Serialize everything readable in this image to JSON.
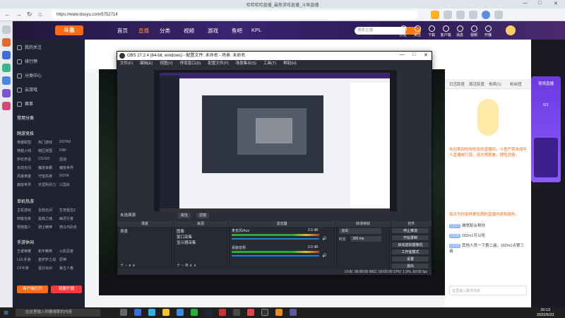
{
  "browser": {
    "tab_title": "哈哈哈哈直播_最新游戏直播_斗鱼直播",
    "url": "https://www.douyu.com/5752714",
    "win_controls": [
      "—",
      "□",
      "✕"
    ]
  },
  "douyu": {
    "logo": "斗鱼",
    "nav": [
      "首页",
      "直播",
      "分类",
      "视频",
      "游戏",
      "鱼吧",
      "KPL"
    ],
    "search_placeholder": "搜索主播",
    "top_icons": [
      "历史",
      "关注",
      "下载",
      "客户端",
      "消息",
      "视频",
      "开播"
    ]
  },
  "sidebar": {
    "items": [
      "我的关注",
      "排行榜",
      "分类中心",
      "云游戏",
      "赛事"
    ],
    "categories_title": "常用分类",
    "hot_title": "网游竞技",
    "hot_grid": [
      "英雄联盟",
      "热门游戏",
      "DOTA2",
      "穿越火线",
      "暗区突围",
      "DNF",
      "炉石传说",
      "CS:GO",
      "逆战",
      "永劫无间",
      "魔兽争霸",
      "魔兽世界",
      "风暴英雄",
      "守望先锋",
      "DOTA",
      "魔兽世界",
      "天涯明月刀",
      "三国杀"
    ],
    "single_title": "单机热游",
    "single_grid": [
      "主机游戏",
      "永劫无间",
      "生死狙击2",
      "刺客信条",
      "黑暗之魂",
      "幽灵行者",
      "怪物猎人",
      "骑士精神",
      "骑马与砍杀"
    ],
    "mobile_title": "手游休闲",
    "mobile_grid": [
      "王者荣耀",
      "和平精英",
      "火影忍者",
      "LOL手游",
      "金铲铲之战",
      "原神",
      "CF手游",
      "蛋仔派对",
      "第五人格"
    ],
    "btn_client": "客户端打开",
    "btn_record": "我要开播"
  },
  "obs": {
    "title": "OBS 27.2.4 (64-bit, windows) - 配置文件: 未命名 - 场景: 未命名",
    "menu": [
      "文件(F)",
      "编辑(E)",
      "视图(V)",
      "停靠窗口(D)",
      "配置文件(P)",
      "场景集合(S)",
      "工具(T)",
      "帮助(H)"
    ],
    "no_source": "未选择源",
    "props_btn": "属性",
    "filter_btn": "滤镜",
    "docks": {
      "scenes": "场景",
      "sources": "来源",
      "mixer": "混音器",
      "transitions": "转场特效",
      "controls": "控件"
    },
    "scene_item": "场景",
    "source_items": [
      "图像",
      "窗口采集",
      "显示器采集"
    ],
    "mixer_tracks": [
      {
        "name": "桌面音频",
        "db": "0.0 dB"
      },
      {
        "name": "麦克风/Aux",
        "db": "0.0 dB"
      }
    ],
    "transition": "淡出",
    "duration_label": "时长",
    "duration_value": "300 ms",
    "controls": [
      "停止推流",
      "开始录制",
      "启动虚拟摄像机",
      "工作室模式",
      "设置",
      "退出"
    ],
    "status": "LIVE: 00:00:00   REC: 00:00:00   CPU: 1.0%, 60.00 fps"
  },
  "chat": {
    "tabs": [
      "日活跃度",
      "周活跃度",
      "贵宾(1)",
      "粉丝团"
    ],
    "lines": [
      "欢迎来到哈哈哈哈的直播间，斗鱼严禁未成年人直播或打赏，请文明观看，理性消费。",
      "每天为你提供更优质的直播内容和服务。"
    ],
    "msgs": [
      {
        "tag": "LV17",
        "text": "雅思配合帮你"
      },
      {
        "tag": "LV16",
        "text": "1fl2m1可以吃"
      },
      {
        "tag": "LV12",
        "text": "其他人员一下第二遍，1fl2m1点第三遍"
      }
    ],
    "input_placeholder": "这里输入聊天内容"
  },
  "promo": {
    "text1": "夜场直播",
    "text2": "0/1"
  },
  "taskbar": {
    "search_placeholder": "在这里输入你要搜索的内容",
    "time": "20:13",
    "date": "2022/6/23"
  },
  "colors": {
    "accent": "#ff6a14",
    "obs_bg": "#2b2e38",
    "douyu_header": "#3a2470"
  }
}
